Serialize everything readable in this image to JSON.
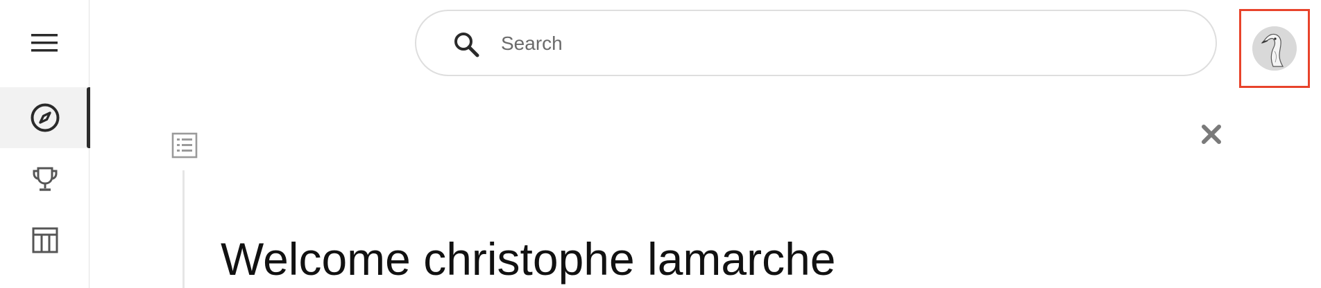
{
  "sidebar": {
    "menu_icon": "hamburger-icon",
    "items": [
      {
        "id": "explore",
        "icon": "compass-icon",
        "active": true
      },
      {
        "id": "trophy",
        "icon": "trophy-icon",
        "active": false
      },
      {
        "id": "table",
        "icon": "table-icon",
        "active": false
      }
    ]
  },
  "header": {
    "search": {
      "placeholder": "Search",
      "value": "",
      "icon": "search-icon"
    },
    "avatar": {
      "icon": "goose-avatar-icon",
      "highlight_color": "#e8432b"
    }
  },
  "main": {
    "list_icon": "list-icon",
    "close_icon": "close-icon",
    "welcome_text": "Welcome christophe lamarche"
  },
  "colors": {
    "accent_border": "#e8432b",
    "active_nav_bg": "#f2f2f2",
    "active_nav_indicator": "#2b2b2b",
    "text": "#111111"
  }
}
